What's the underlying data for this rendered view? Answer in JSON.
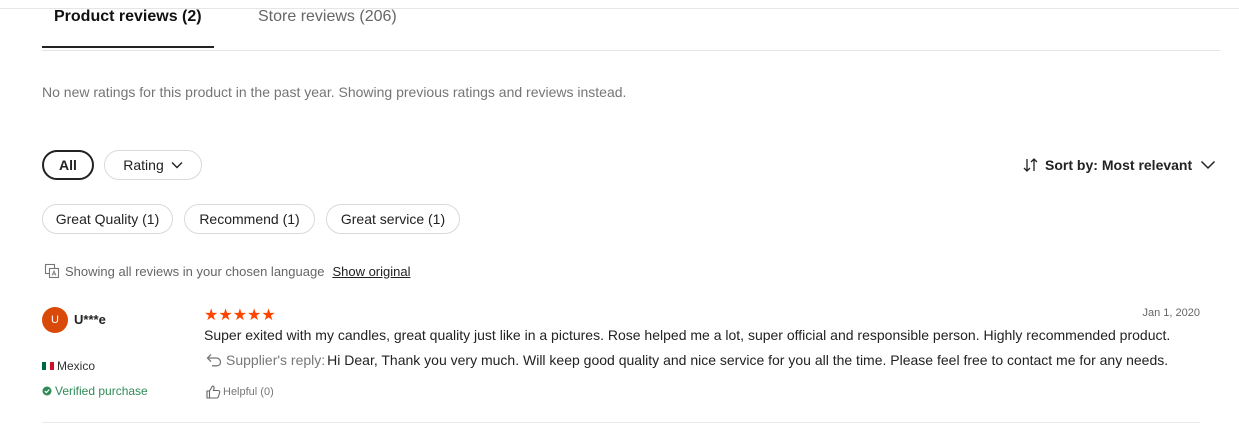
{
  "tabs": [
    {
      "label": "Product reviews (2)"
    },
    {
      "label": "Store reviews (206)"
    }
  ],
  "notice": "No new ratings for this product in the past year. Showing previous ratings and reviews instead.",
  "filters": {
    "all": "All",
    "rating": "Rating",
    "tags": [
      {
        "label": "Great Quality (1)"
      },
      {
        "label": "Recommend (1)"
      },
      {
        "label": "Great service (1)"
      }
    ]
  },
  "sort": {
    "prefix": "Sort by:",
    "value": "Most relevant"
  },
  "language_note": {
    "text": "Showing all reviews in your chosen language",
    "link": "Show original"
  },
  "review": {
    "avatar_initial": "U",
    "user": "U***e",
    "country": "Mexico",
    "verified": "Verified purchase",
    "stars": "★★★★★",
    "date": "Jan 1, 2020",
    "text": "Super exited with my candles, great quality just like in a pictures. Rose helped me a lot, super official and responsible person. Highly recommended product.",
    "reply_label": "Supplier's reply:",
    "reply_text": "Hi Dear, Thank you very much. Will keep good quality and nice service for you all the time. Please feel free to contact me for any needs.",
    "helpful": "Helpful (0)",
    "rating": 5
  },
  "colors": {
    "star": "#ff4400",
    "avatar": "#d94a0a",
    "verified": "#2e8b57"
  }
}
